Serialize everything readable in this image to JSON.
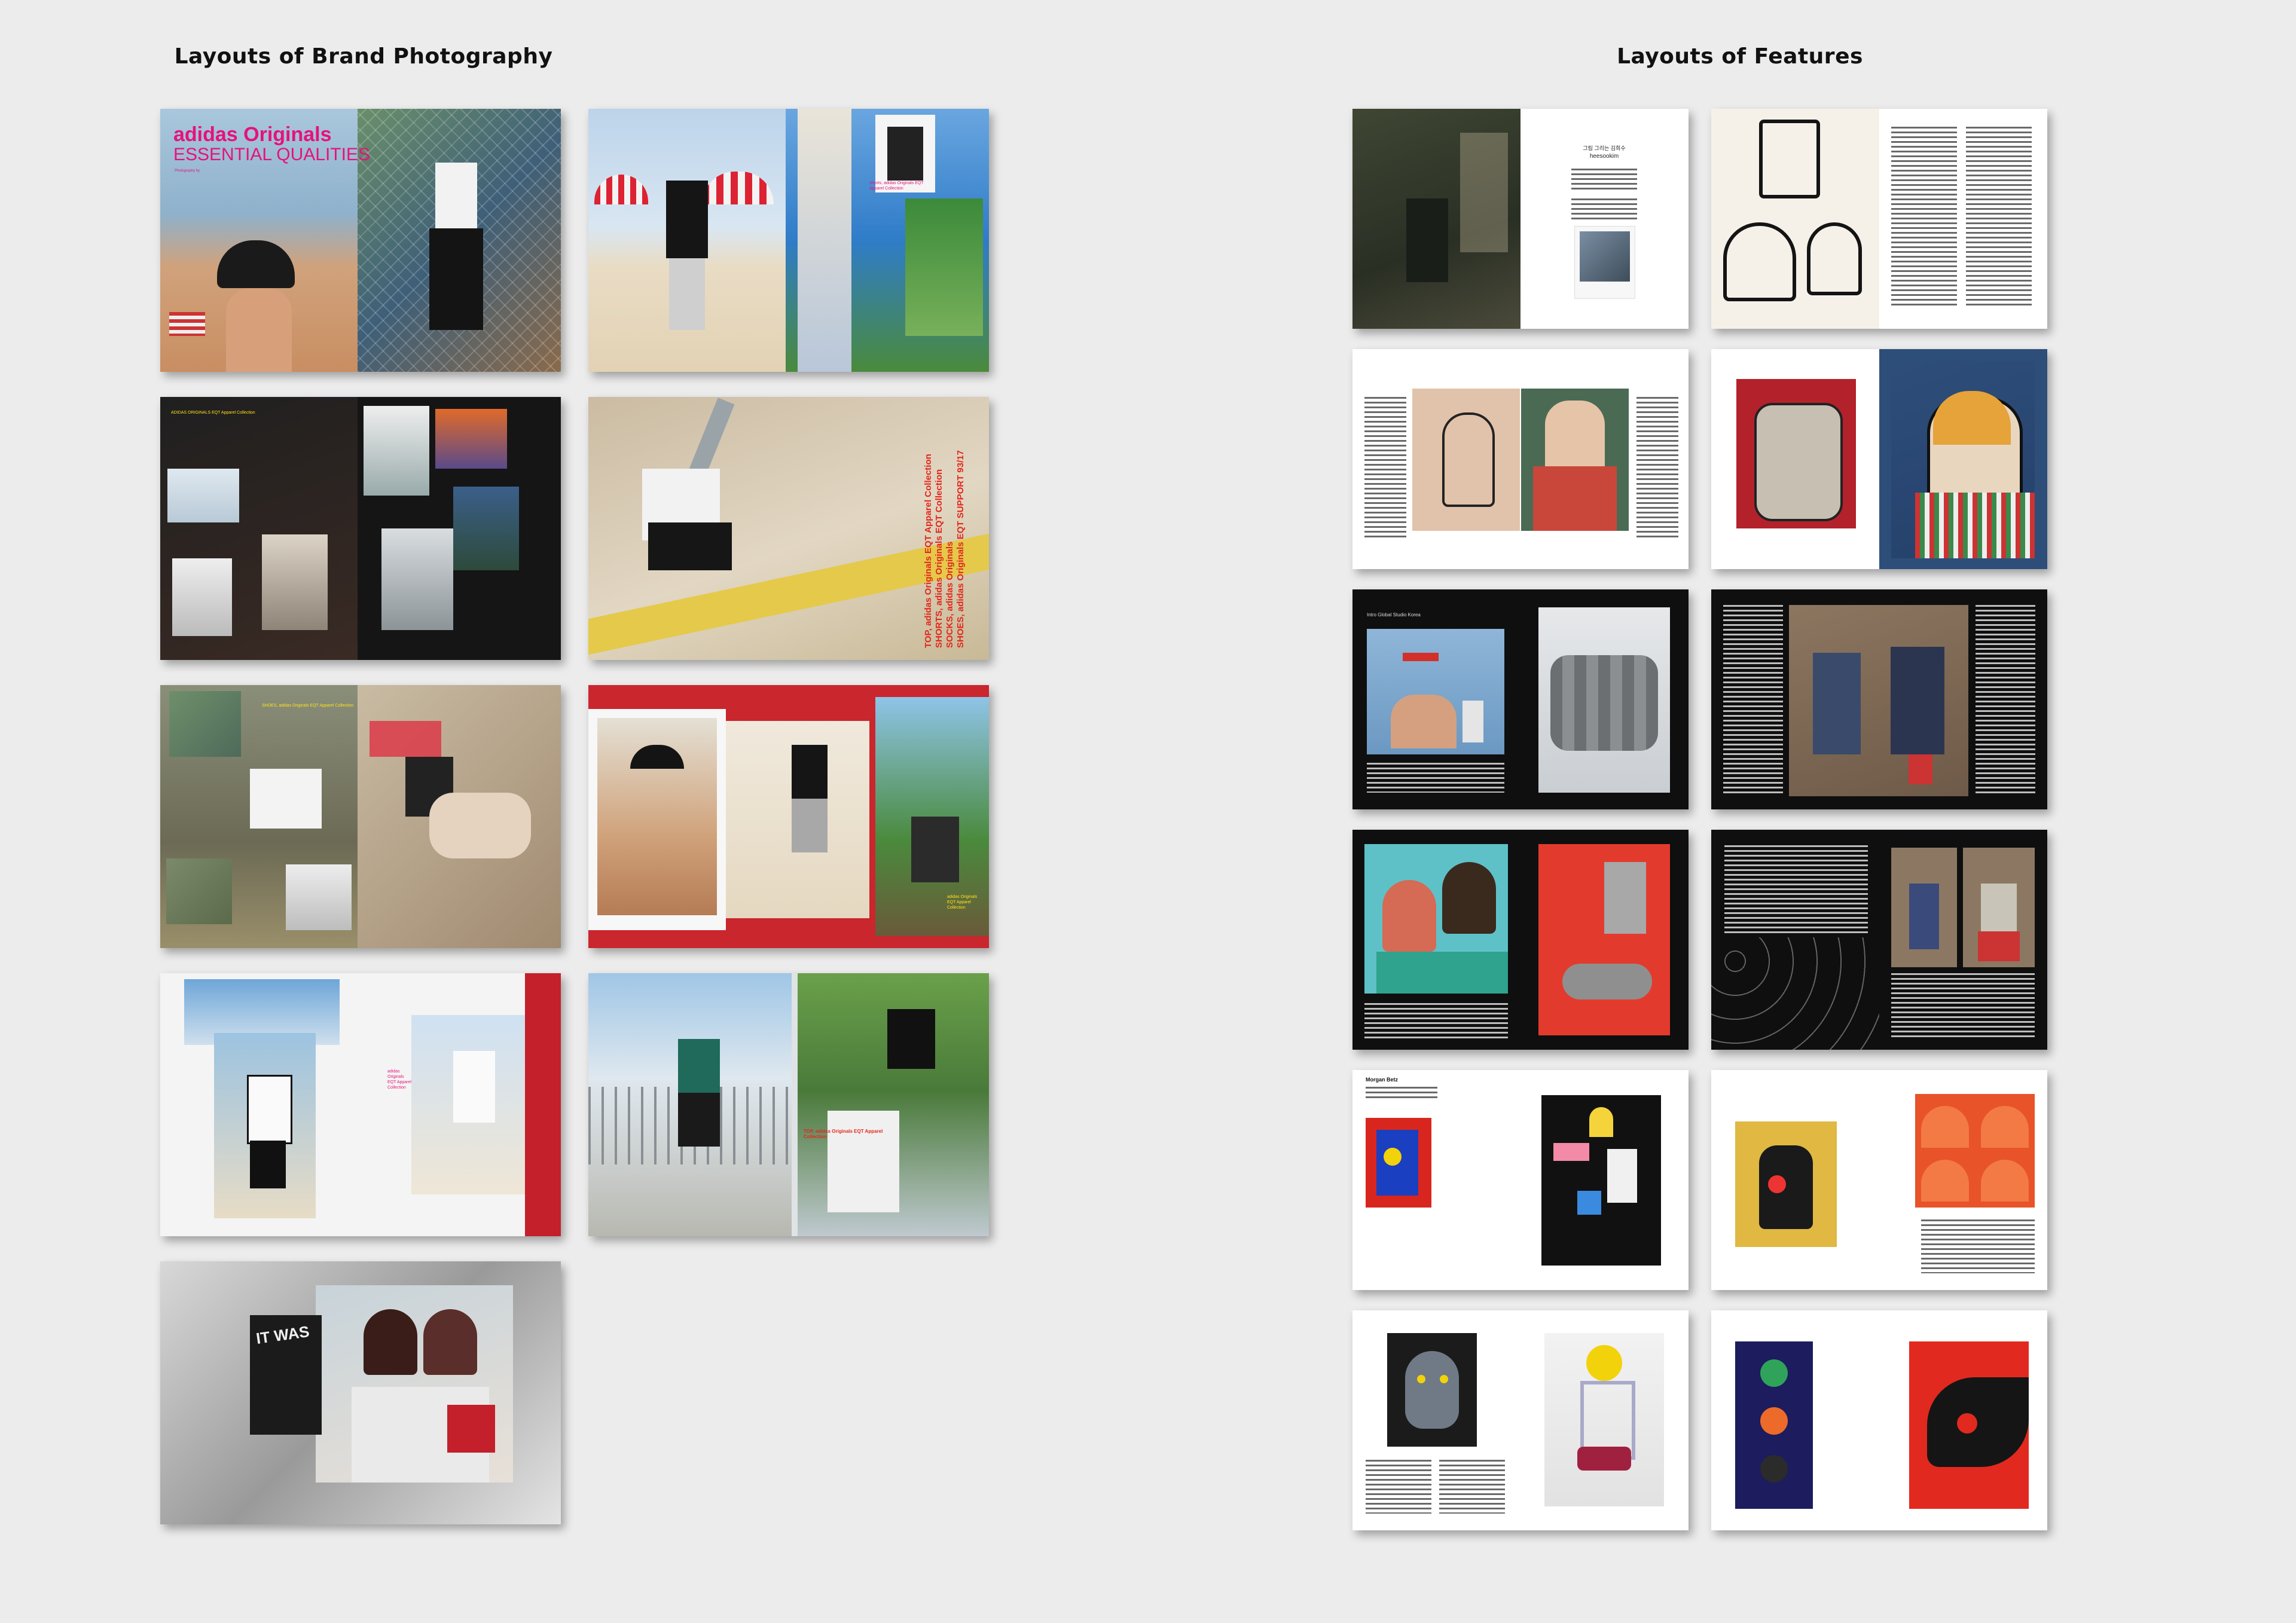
{
  "sections": {
    "brand_photography_title": "Layouts of Brand Photography",
    "features_title": "Layouts of Features"
  },
  "spread1": {
    "brand": "adidas Originals",
    "headline": "ESSENTIAL QUALITIES",
    "credit": "Photography by"
  },
  "spread2": {
    "caption": "Shorts, adidas Originals EQT Apparel Collection"
  },
  "spread3": {
    "caption": "ADIDAS ORIGINALS EQT Apparel Collection"
  },
  "spread4": {
    "caption_lines": [
      "TOP, adidas Originals EQT Apparel Collection",
      "SHORTS, adidas Originals EQT Collection",
      "SOCKS, adidas Originals",
      "SHOES, adidas Originals EQT SUPPORT 93/17"
    ]
  },
  "spread5": {
    "caption": "SHOES, adidas Originals EQT Apparel Collection"
  },
  "spread6": {
    "caption": "adidas Originals EQT Apparel Collection"
  },
  "spread7": {
    "caption": "adidas Originals EQT Apparel Collection"
  },
  "spread8": {
    "caption": "TOP, adidas Originals EQT Apparel Collection"
  },
  "spread9": {
    "graffiti": "IT WAS"
  },
  "feature1": {
    "korean_title": "그림 그리는 김희수",
    "name": "heesookim"
  },
  "feature5": {
    "heading": "Intro Global Studio Korea"
  },
  "feature11": {
    "name": "Morgan Betz"
  }
}
